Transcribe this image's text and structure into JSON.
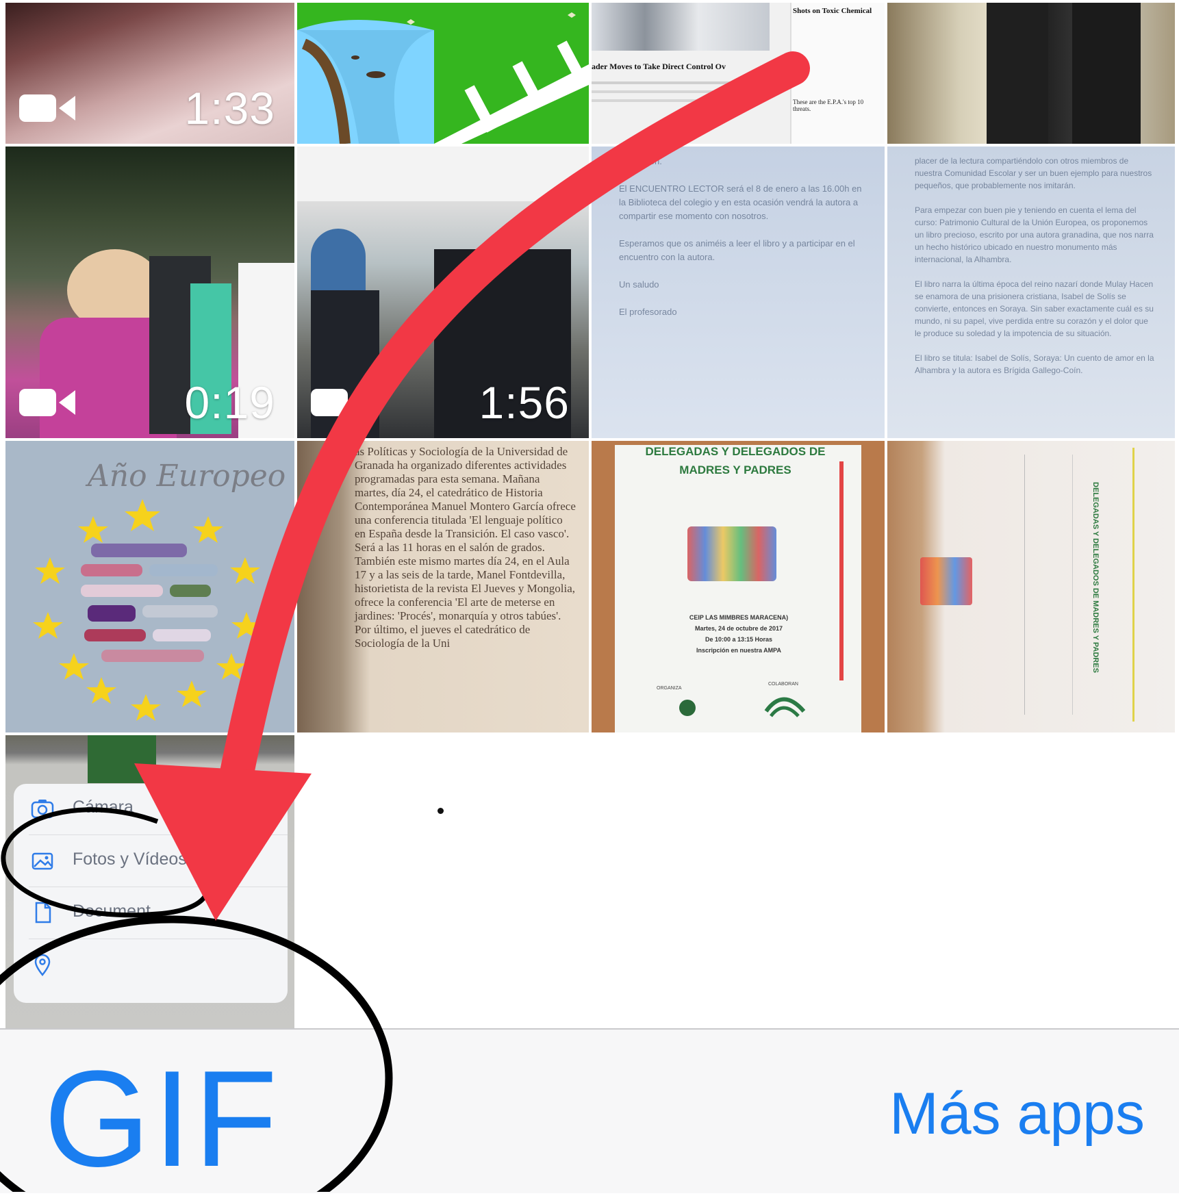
{
  "photos": [
    {
      "kind": "video",
      "duration": "1:33"
    },
    {
      "kind": "photo"
    },
    {
      "kind": "photo"
    },
    {
      "kind": "photo"
    },
    {
      "kind": "video",
      "duration": "0:19"
    },
    {
      "kind": "video",
      "duration": "1:56"
    },
    {
      "kind": "photo"
    },
    {
      "kind": "photo"
    },
    {
      "kind": "photo"
    },
    {
      "kind": "photo"
    },
    {
      "kind": "photo"
    },
    {
      "kind": "photo"
    },
    {
      "kind": "photo"
    }
  ],
  "thumb_text": {
    "tile3_head": "Shots on Toxic Chemical",
    "tile3_line": "ader Moves to Take Direct Control Ov",
    "tile3_sub": "These are the E.P.A.'s top 10 threats.",
    "doc1": "de edición.\n\nEl ENCUENTRO LECTOR será el 8 de enero a las 16.00h en la Biblioteca del colegio y en esta ocasión vendrá la autora a compartir ese momento con nosotros.\n\nEsperamos que os animéis a leer el libro y a participar en el encuentro con la autora.\n\nUn saludo\n\nEl profesorado",
    "doc2": "placer de la lectura compartiéndolo con otros miembros de nuestra Comunidad Escolar y ser un buen ejemplo para nuestros pequeños, que probablemente nos imitarán.\n\nPara empezar con buen pie y teniendo en cuenta el lema del curso: Patrimonio Cultural de la Unión Europea, os proponemos un libro precioso, escrito por una autora granadina, que nos narra un hecho histórico ubicado en nuestro monumento más internacional, la Alhambra.\n\nEl libro narra la última época del reino nazarí donde Mulay Hacen se enamora de una prisionera cristiana, Isabel de Solís se convierte, entonces en Soraya. Sin saber exactamente cuál es su mundo, ni su papel, vive perdida entre su corazón y el dolor que le produce su soledad y la impotencia de su situación.\n\nEl libro se titula: Isabel de Solís, Soraya: Un cuento de amor en la Alhambra y la autora es Brígida Gallego-Coín.",
    "poster_title": "Año Europeo",
    "news": "as Políticas y Sociología de la Universidad de Granada ha organizado diferentes actividades programadas para esta semana. Mañana martes, día 24, el catedrático de Historia Contemporánea Manuel Montero García ofrece una conferencia titulada 'El lenguaje político en España desde la Transición. El caso vasco'. Será a las 11 horas en el salón de grados.\nTambién este mismo martes día 24, en el Aula 17 y a las seis de la tarde, Manel Fontdevilla, historietista de la revista El Jueves y Mongolia, ofrece la conferencia 'El arte de meterse en jardines: 'Procés', monarquía y otros tabúes'.\nPor último, el jueves el catedrático de Sociología de la Uni",
    "flyer_title": "DELEGADAS Y DELEGADOS DE MADRES Y PADRES",
    "flyer_info": "CEIP LAS MIMBRES MARACENA)\nMartes, 24 de octubre de 2017\nDe 10:00 a 13:15 Horas\nInscripción en nuestra AMPA",
    "flyer_org": "ORGANIZA",
    "flyer_col": "COLABORAN",
    "brochure_title": "DELEGADAS Y DELEGADOS DE MADRES Y PADRES"
  },
  "attach_menu": {
    "items": [
      {
        "label": "Cámara",
        "icon": "camera-icon"
      },
      {
        "label": "Fotos y Vídeos",
        "icon": "photos-icon"
      },
      {
        "label": "Document",
        "icon": "document-icon"
      },
      {
        "label": "",
        "icon": "location-icon"
      }
    ]
  },
  "bottom_bar": {
    "gif_label": "GIF",
    "more_apps_label": "Más apps"
  },
  "colors": {
    "accent": "#1a7ef0",
    "arrow": "#f23845",
    "circle": "#000000",
    "star": "#f6d21c"
  }
}
